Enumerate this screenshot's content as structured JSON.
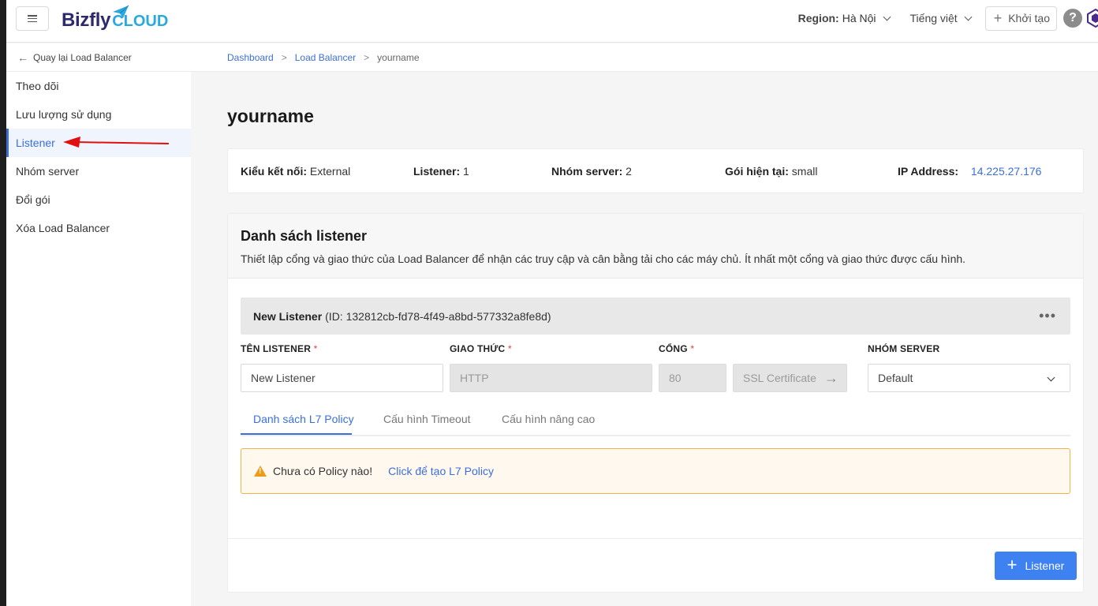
{
  "header": {
    "logo_main": "Bizfly",
    "logo_sub": "CLOUD",
    "region_label": "Region:",
    "region_value": "Hà Nội",
    "language": "Tiếng việt",
    "create_label": "Khởi tạo",
    "help_glyph": "?"
  },
  "sidebar": {
    "back_label": "Quay lại Load Balancer",
    "items": [
      {
        "label": "Theo dõi"
      },
      {
        "label": "Lưu lượng sử dụng"
      },
      {
        "label": "Listener"
      },
      {
        "label": "Nhóm server"
      },
      {
        "label": "Đổi gói"
      },
      {
        "label": "Xóa Load Balancer"
      }
    ]
  },
  "breadcrumb": [
    "Dashboard",
    "Load Balancer",
    "yourname"
  ],
  "page_title": "yourname",
  "info": {
    "type_label": "Kiểu kết nối:",
    "type_value": "External",
    "listener_label": "Listener:",
    "listener_value": "1",
    "group_label": "Nhóm server:",
    "group_value": "2",
    "plan_label": "Gói hiện tại:",
    "plan_value": "small",
    "ip_label": "IP Address:",
    "ip_value": "14.225.27.176"
  },
  "listener_section": {
    "title": "Danh sách listener",
    "description": "Thiết lập cổng và giao thức của Load Balancer để nhận các truy cập và cân bằng tải cho các máy chủ. Ít nhất một cổng và giao thức được cấu hình.",
    "listener_name": "New Listener",
    "listener_id": "(ID: 132812cb-fd78-4f49-a8bd-577332a8fe8d)",
    "more_glyph": "•••",
    "fields": {
      "name_label": "TÊN LISTENER",
      "name_value": "New Listener",
      "protocol_label": "GIAO THỨC",
      "protocol_value": "HTTP",
      "port_label": "CỔNG",
      "port_value": "80",
      "ssl_label": "SSL Certificate",
      "group_label": "NHÓM SERVER",
      "group_value": "Default",
      "required_mark": "*"
    },
    "tabs": [
      "Danh sách L7 Policy",
      "Cấu hình Timeout",
      "Cấu hình nâng cao"
    ],
    "alert_text": "Chưa có Policy nào!",
    "alert_link": "Click để tạo L7 Policy",
    "add_button": "Listener"
  },
  "colors": {
    "accent": "#3b6fd8",
    "primary_button": "#3d82f0",
    "warning": "#f09a1a",
    "annotation_arrow": "#e01010"
  }
}
